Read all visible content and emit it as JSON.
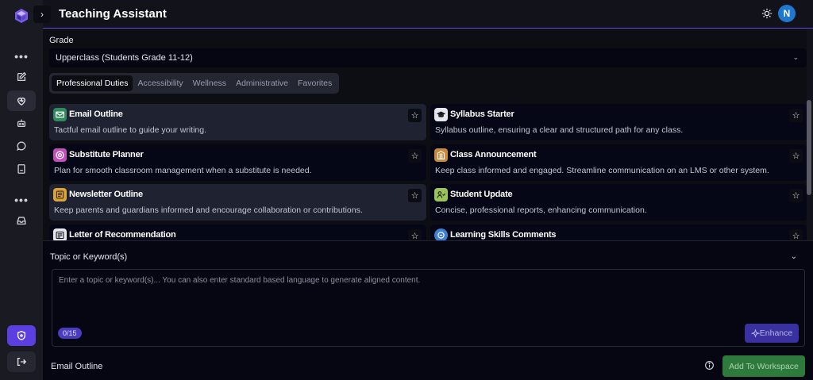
{
  "header": {
    "title": "Teaching Assistant",
    "avatar_initial": "N",
    "theme_icon": "sun-icon"
  },
  "rail": {
    "items": [
      {
        "name": "more-icon",
        "label": "•••"
      },
      {
        "name": "edit-icon"
      },
      {
        "name": "heart-icon",
        "active": true
      },
      {
        "name": "robot-icon"
      },
      {
        "name": "chat-icon"
      },
      {
        "name": "notebook-icon"
      },
      {
        "name": "more-icon-2",
        "label": "•••"
      },
      {
        "name": "inbox-icon"
      },
      {
        "name": "shield-icon",
        "accent": "#5b3fe0"
      },
      {
        "name": "logout-icon"
      }
    ]
  },
  "grade": {
    "label": "Grade",
    "value": "Upperclass (Students Grade 11-12)"
  },
  "tabs": [
    {
      "label": "Professional Duties",
      "active": true
    },
    {
      "label": "Accessibility"
    },
    {
      "label": "Wellness"
    },
    {
      "label": "Administrative"
    },
    {
      "label": "Favorites"
    }
  ],
  "cards": [
    {
      "title": "Email Outline",
      "desc": "Tactful email outline to guide your writing.",
      "icon": "email-icon",
      "icon_bg": "#2f8a5c",
      "highlight": true
    },
    {
      "title": "Syllabus Starter",
      "desc": "Syllabus outline, ensuring a clear and structured path for any class.",
      "icon": "graduation-cap-icon",
      "icon_bg": "#e6e6ee"
    },
    {
      "title": "Substitute Planner",
      "desc": "Plan for smooth classroom management when a substitute is needed.",
      "icon": "lifebuoy-icon",
      "icon_bg": "#c04fb8"
    },
    {
      "title": "Class Announcement",
      "desc": "Keep class informed and engaged. Streamline communication on an LMS or other system.",
      "icon": "building-icon",
      "icon_bg": "#c8893a"
    },
    {
      "title": "Newsletter Outline",
      "desc": "Keep parents and guardians informed and encourage collaboration or contributions.",
      "icon": "newsletter-icon",
      "icon_bg": "#d9a23a",
      "highlight": true
    },
    {
      "title": "Student Update",
      "desc": "Concise, professional reports, enhancing communication.",
      "icon": "student-icon",
      "icon_bg": "#9bc45a"
    },
    {
      "title": "Letter of Recommendation",
      "desc": "",
      "icon": "letter-icon",
      "icon_bg": "#e6e6ee"
    },
    {
      "title": "Learning Skills Comments",
      "desc": "",
      "icon": "comments-icon",
      "icon_bg": "#3f7fd0"
    }
  ],
  "topic": {
    "label": "Topic or Keyword(s)",
    "placeholder": "Enter a topic or keyword(s)... You can also enter standard based language to generate aligned content.",
    "counter": "0/15",
    "enhance_label": "Enhance"
  },
  "footer": {
    "selected_tool": "Email Outline",
    "workspace_label": "Add To Workspace"
  },
  "colors": {
    "accent": "#5b4bd6",
    "workspace_green": "#2e7a3c"
  }
}
